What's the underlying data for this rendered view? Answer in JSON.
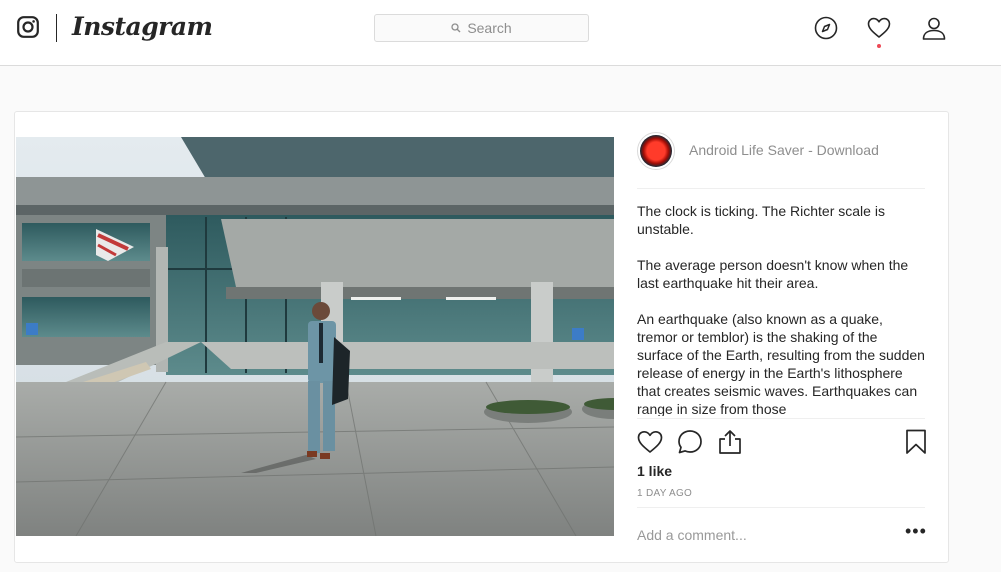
{
  "nav": {
    "wordmark": "Instagram",
    "search_placeholder": "Search",
    "icons": [
      "camera-logo-icon",
      "compass-icon",
      "heart-icon",
      "profile-icon"
    ],
    "notification_dot_color": "#ed4956"
  },
  "post": {
    "account_name": "Android Life Saver - Download",
    "caption_paragraphs": [
      "The clock is ticking. The Richter scale is unstable.",
      "The average person doesn't know when the last earthquake hit their area.",
      "An earthquake (also known as a quake, tremor or temblor) is the shaking of the surface of the Earth, resulting from the sudden release of energy in the Earth's lithosphere that creates seismic waves. Earthquakes can range in size from those"
    ],
    "likes": "1 like",
    "timestamp": "1 DAY AGO",
    "comment_placeholder": "Add a comment...",
    "more_label": "•••",
    "action_icons": [
      "heart-icon",
      "comment-icon",
      "share-icon",
      "bookmark-icon"
    ]
  }
}
